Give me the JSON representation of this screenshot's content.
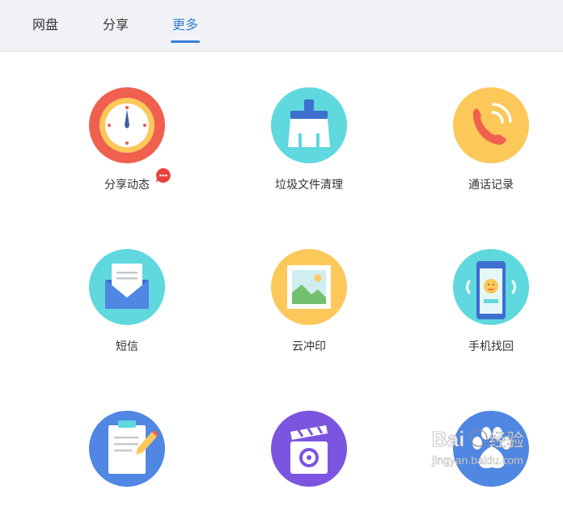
{
  "tabs": [
    {
      "label": "网盘",
      "active": false
    },
    {
      "label": "分享",
      "active": false
    },
    {
      "label": "更多",
      "active": true
    }
  ],
  "accent_color": "#3b7fd6",
  "items": [
    {
      "label": "分享动态",
      "icon": "clock-icon",
      "badge": "notification-badge-icon"
    },
    {
      "label": "垃圾文件清理",
      "icon": "brush-icon"
    },
    {
      "label": "通话记录",
      "icon": "phone-icon"
    },
    {
      "label": "短信",
      "icon": "envelope-icon"
    },
    {
      "label": "云冲印",
      "icon": "photo-icon"
    },
    {
      "label": "手机找回",
      "icon": "find-phone-icon"
    },
    {
      "label": "",
      "icon": "clipboard-icon"
    },
    {
      "label": "",
      "icon": "video-icon"
    },
    {
      "label": "",
      "icon": "paw-icon"
    }
  ],
  "watermark": {
    "brand": "Baidu经验",
    "url": "jingyan.baidu.com"
  }
}
